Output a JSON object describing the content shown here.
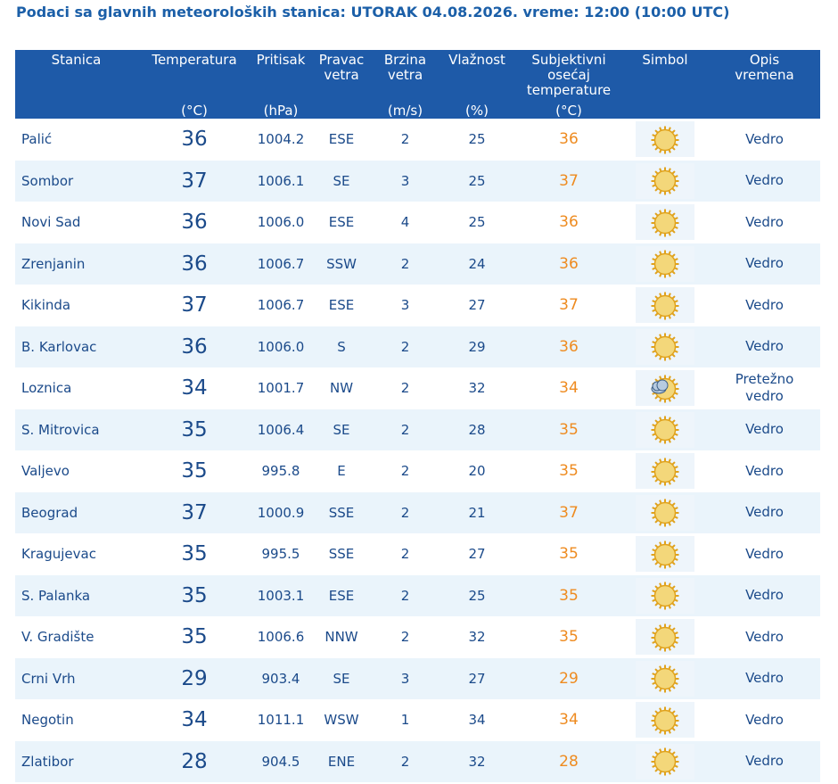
{
  "page": {
    "title": "Podaci sa glavnih meteoroloških stanica:  UTORAK 04.08.2026.  vreme: 12:00 (10:00 UTC)"
  },
  "table": {
    "headers": [
      {
        "label_lines": [
          "Stanica"
        ],
        "unit": ""
      },
      {
        "label_lines": [
          "Temperatura"
        ],
        "unit": "(°C)"
      },
      {
        "label_lines": [
          "Pritisak"
        ],
        "unit": "(hPa)"
      },
      {
        "label_lines": [
          "Pravac",
          "vetra"
        ],
        "unit": ""
      },
      {
        "label_lines": [
          "Brzina",
          "vetra"
        ],
        "unit": "(m/s)"
      },
      {
        "label_lines": [
          "Vlažnost"
        ],
        "unit": "(%)"
      },
      {
        "label_lines": [
          "Subjektivni",
          "osećaj",
          "temperature"
        ],
        "unit": "(°C)"
      },
      {
        "label_lines": [
          "Simbol"
        ],
        "unit": ""
      },
      {
        "label_lines": [
          "Opis",
          "vremena"
        ],
        "unit": ""
      }
    ],
    "rows": [
      {
        "station": "Palić",
        "temp": "36",
        "pressure": "1004.2",
        "wind_dir": "ESE",
        "wind_speed": "2",
        "humidity": "25",
        "feels": "36",
        "symbol": "sun-icon",
        "desc_lines": [
          "Vedro"
        ]
      },
      {
        "station": "Sombor",
        "temp": "37",
        "pressure": "1006.1",
        "wind_dir": "SE",
        "wind_speed": "3",
        "humidity": "25",
        "feels": "37",
        "symbol": "sun-icon",
        "desc_lines": [
          "Vedro"
        ]
      },
      {
        "station": "Novi Sad",
        "temp": "36",
        "pressure": "1006.0",
        "wind_dir": "ESE",
        "wind_speed": "4",
        "humidity": "25",
        "feels": "36",
        "symbol": "sun-icon",
        "desc_lines": [
          "Vedro"
        ]
      },
      {
        "station": "Zrenjanin",
        "temp": "36",
        "pressure": "1006.7",
        "wind_dir": "SSW",
        "wind_speed": "2",
        "humidity": "24",
        "feels": "36",
        "symbol": "sun-icon",
        "desc_lines": [
          "Vedro"
        ]
      },
      {
        "station": "Kikinda",
        "temp": "37",
        "pressure": "1006.7",
        "wind_dir": "ESE",
        "wind_speed": "3",
        "humidity": "27",
        "feels": "37",
        "symbol": "sun-icon",
        "desc_lines": [
          "Vedro"
        ]
      },
      {
        "station": "B. Karlovac",
        "temp": "36",
        "pressure": "1006.0",
        "wind_dir": "S",
        "wind_speed": "2",
        "humidity": "29",
        "feels": "36",
        "symbol": "sun-icon",
        "desc_lines": [
          "Vedro"
        ]
      },
      {
        "station": "Loznica",
        "temp": "34",
        "pressure": "1001.7",
        "wind_dir": "NW",
        "wind_speed": "2",
        "humidity": "32",
        "feels": "34",
        "symbol": "sun-cloud-icon",
        "desc_lines": [
          "Pretežno",
          "vedro"
        ]
      },
      {
        "station": "S. Mitrovica",
        "temp": "35",
        "pressure": "1006.4",
        "wind_dir": "SE",
        "wind_speed": "2",
        "humidity": "28",
        "feels": "35",
        "symbol": "sun-icon",
        "desc_lines": [
          "Vedro"
        ]
      },
      {
        "station": "Valjevo",
        "temp": "35",
        "pressure": "995.8",
        "wind_dir": "E",
        "wind_speed": "2",
        "humidity": "20",
        "feels": "35",
        "symbol": "sun-icon",
        "desc_lines": [
          "Vedro"
        ]
      },
      {
        "station": "Beograd",
        "temp": "37",
        "pressure": "1000.9",
        "wind_dir": "SSE",
        "wind_speed": "2",
        "humidity": "21",
        "feels": "37",
        "symbol": "sun-icon",
        "desc_lines": [
          "Vedro"
        ]
      },
      {
        "station": "Kragujevac",
        "temp": "35",
        "pressure": "995.5",
        "wind_dir": "SSE",
        "wind_speed": "2",
        "humidity": "27",
        "feels": "35",
        "symbol": "sun-icon",
        "desc_lines": [
          "Vedro"
        ]
      },
      {
        "station": "S. Palanka",
        "temp": "35",
        "pressure": "1003.1",
        "wind_dir": "ESE",
        "wind_speed": "2",
        "humidity": "25",
        "feels": "35",
        "symbol": "sun-icon",
        "desc_lines": [
          "Vedro"
        ]
      },
      {
        "station": "V. Gradište",
        "temp": "35",
        "pressure": "1006.6",
        "wind_dir": "NNW",
        "wind_speed": "2",
        "humidity": "32",
        "feels": "35",
        "symbol": "sun-icon",
        "desc_lines": [
          "Vedro"
        ]
      },
      {
        "station": "Crni Vrh",
        "temp": "29",
        "pressure": "903.4",
        "wind_dir": "SE",
        "wind_speed": "3",
        "humidity": "27",
        "feels": "29",
        "symbol": "sun-icon",
        "desc_lines": [
          "Vedro"
        ]
      },
      {
        "station": "Negotin",
        "temp": "34",
        "pressure": "1011.1",
        "wind_dir": "WSW",
        "wind_speed": "1",
        "humidity": "34",
        "feels": "34",
        "symbol": "sun-icon",
        "desc_lines": [
          "Vedro"
        ]
      },
      {
        "station": "Zlatibor",
        "temp": "28",
        "pressure": "904.5",
        "wind_dir": "ENE",
        "wind_speed": "2",
        "humidity": "32",
        "feels": "28",
        "symbol": "sun-icon",
        "desc_lines": [
          "Vedro"
        ]
      }
    ]
  },
  "colors": {
    "title": "#1b5fa8",
    "header_bg": "#1e5aa8",
    "header_text": "#ffffff",
    "row_text": "#1b4a8a",
    "row_alt_bg": "#eaf4fb",
    "feels_text": "#ee8b20",
    "sun_fill": "#f3d77a",
    "sun_stroke": "#e0a21c"
  }
}
